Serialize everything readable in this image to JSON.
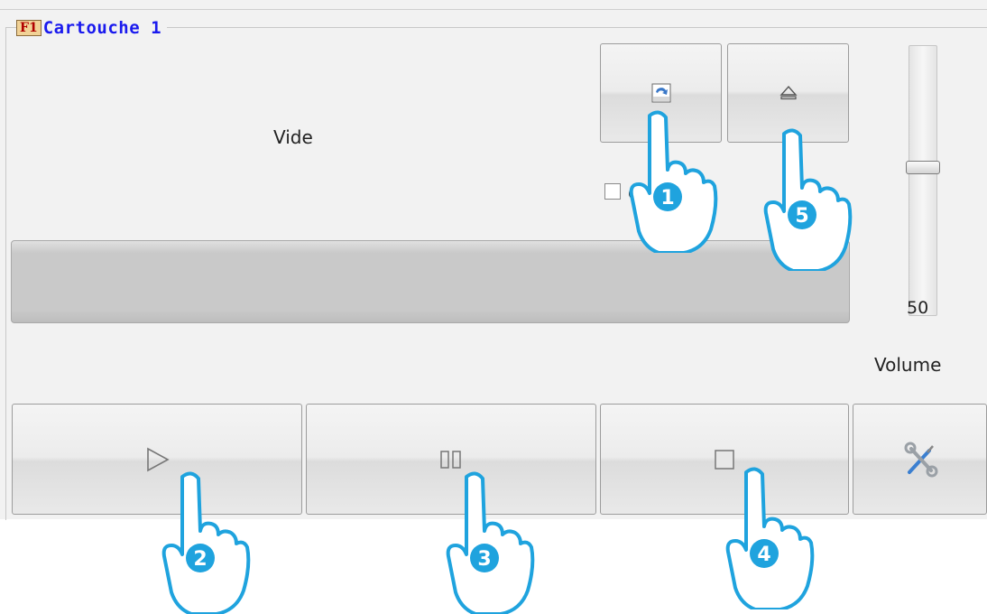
{
  "cartridge": {
    "badge": "F1",
    "title": "Cartouche 1",
    "status": "Vide",
    "checkbox_label": "cle",
    "checkbox_checked": false,
    "progress": 0
  },
  "buttons": {
    "load_icon": "load-cart-icon",
    "eject_icon": "eject-icon",
    "play_icon": "play-icon",
    "pause_icon": "pause-icon",
    "stop_icon": "stop-icon",
    "settings_icon": "wrench-screwdriver-icon"
  },
  "volume": {
    "value": "50",
    "label": "Volume",
    "level": 50
  },
  "callouts": [
    "1",
    "2",
    "3",
    "4",
    "5"
  ],
  "colors": {
    "title": "#1a1aee",
    "badge_text": "#b00000",
    "badge_bg": "#f1d296",
    "callout": "#1fa3de"
  }
}
